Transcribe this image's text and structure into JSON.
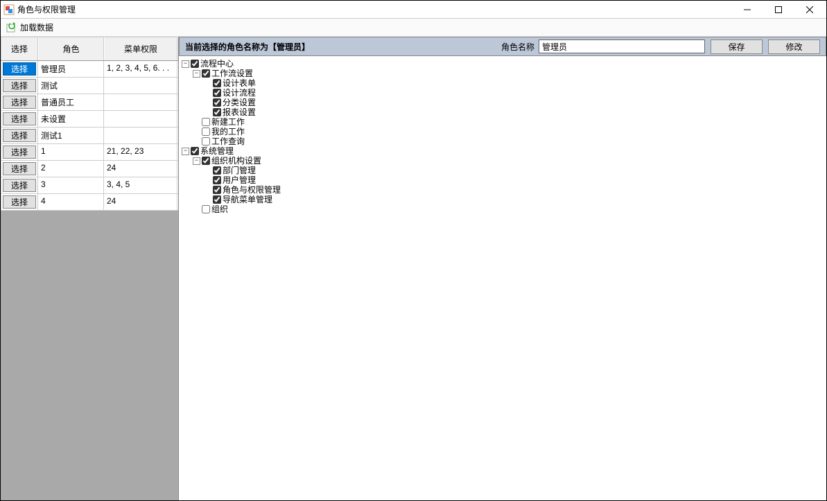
{
  "titlebar": {
    "title": "角色与权限管理"
  },
  "toolbar": {
    "load_label": "加载数据"
  },
  "grid": {
    "headers": {
      "select": "选择",
      "role": "角色",
      "perm": "菜单权限"
    },
    "select_btn_label": "选择",
    "rows": [
      {
        "role": "管理员",
        "perm": "1, 2, 3, 4, 5, 6. . .",
        "selected": true
      },
      {
        "role": "测试",
        "perm": "",
        "selected": false
      },
      {
        "role": "普通员工",
        "perm": "",
        "selected": false
      },
      {
        "role": "未设置",
        "perm": "",
        "selected": false
      },
      {
        "role": "测试1",
        "perm": "",
        "selected": false
      },
      {
        "role": "1",
        "perm": "21, 22, 23",
        "selected": false
      },
      {
        "role": "2",
        "perm": "24",
        "selected": false
      },
      {
        "role": "3",
        "perm": "3, 4, 5",
        "selected": false
      },
      {
        "role": "4",
        "perm": "24",
        "selected": false
      }
    ]
  },
  "formbar": {
    "status_text": "当前选择的角色名称为【管理员】",
    "role_label": "角色名称",
    "role_value": "管理员",
    "save_label": "保存",
    "modify_label": "修改"
  },
  "tree": [
    {
      "label": "流程中心",
      "checked": true,
      "expanded": true,
      "children": [
        {
          "label": "工作流设置",
          "checked": true,
          "expanded": true,
          "children": [
            {
              "label": "设计表单",
              "checked": true
            },
            {
              "label": "设计流程",
              "checked": true
            },
            {
              "label": "分类设置",
              "checked": true
            },
            {
              "label": "报表设置",
              "checked": true
            }
          ]
        },
        {
          "label": "新建工作",
          "checked": false
        },
        {
          "label": "我的工作",
          "checked": false
        },
        {
          "label": "工作查询",
          "checked": false
        }
      ]
    },
    {
      "label": "系统管理",
      "checked": true,
      "expanded": true,
      "children": [
        {
          "label": "组织机构设置",
          "checked": true,
          "expanded": true,
          "children": [
            {
              "label": "部门管理",
              "checked": true
            },
            {
              "label": "用户管理",
              "checked": true
            },
            {
              "label": "角色与权限管理",
              "checked": true
            },
            {
              "label": "导航菜单管理",
              "checked": true
            }
          ]
        },
        {
          "label": "组织",
          "checked": false
        }
      ]
    }
  ]
}
